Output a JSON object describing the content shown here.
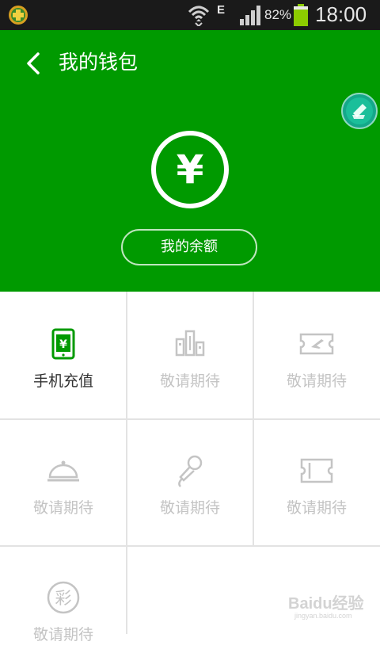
{
  "status_bar": {
    "network_type": "E",
    "battery_percent": "82%",
    "time": "18:00"
  },
  "header": {
    "title": "我的钱包",
    "currency_symbol": "¥",
    "balance_button_label": "我的余额"
  },
  "grid": {
    "items": [
      {
        "label": "手机充值",
        "icon": "phone-yuan-icon",
        "active": true
      },
      {
        "label": "敬请期待",
        "icon": "city-buildings-icon",
        "active": false
      },
      {
        "label": "敬请期待",
        "icon": "flight-ticket-icon",
        "active": false
      },
      {
        "label": "敬请期待",
        "icon": "food-dome-icon",
        "active": false
      },
      {
        "label": "敬请期待",
        "icon": "microphone-icon",
        "active": false
      },
      {
        "label": "敬请期待",
        "icon": "ticket-icon",
        "active": false
      },
      {
        "label": "敬请期待",
        "icon": "lottery-cai-icon",
        "active": false
      }
    ],
    "lottery_glyph": "彩"
  },
  "watermark": {
    "text": "Baidu经验",
    "url": "jingyan.baidu.com"
  },
  "colors": {
    "header_green": "#009a00",
    "active_icon_green": "#009a00",
    "inactive_gray": "#c4c4c4",
    "active_text": "#333333"
  }
}
